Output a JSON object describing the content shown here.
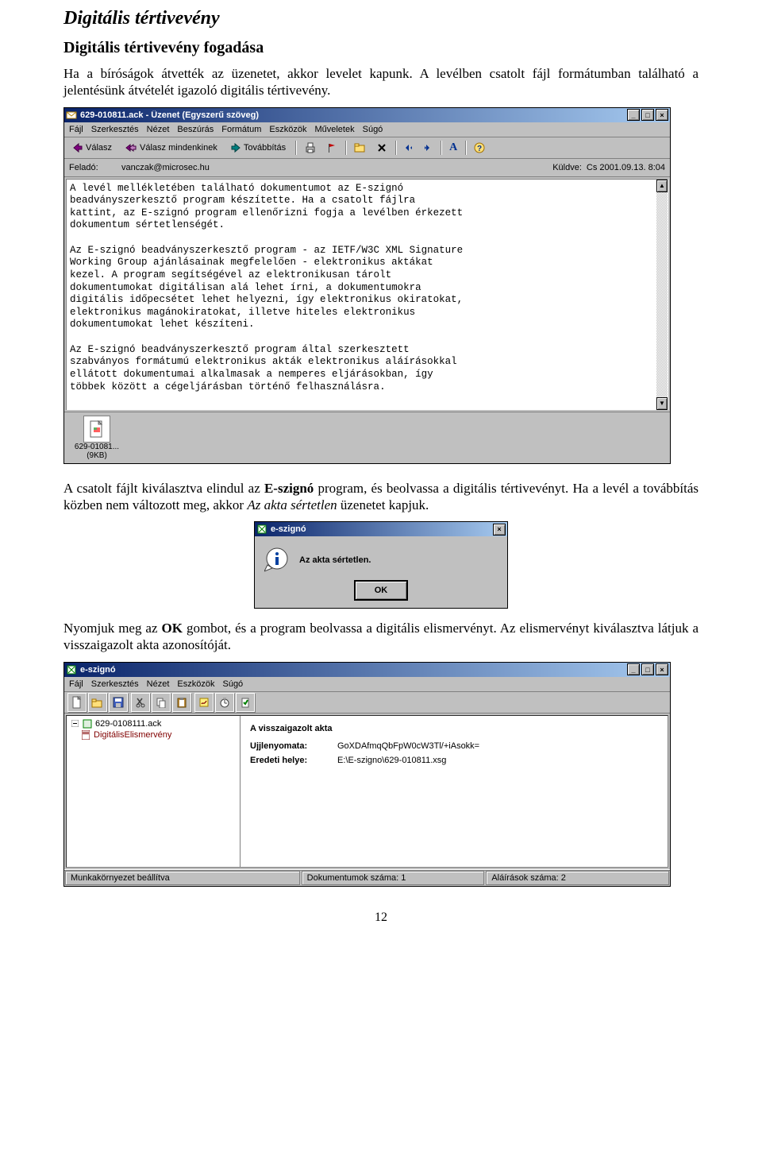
{
  "doc": {
    "h1": "Digitális tértivevény",
    "h2": "Digitális tértivevény fogadása",
    "p1": "Ha a bíróságok átvették az üzenetet, akkor levelet kapunk. A levélben csatolt fájl formátumban található a jelentésünk átvételét igazoló digitális tértivevény.",
    "p2_a": "A csatolt fájlt kiválasztva elindul az ",
    "p2_b": "E-szignó",
    "p2_c": " program, és beolvassa a digitális tértivevényt. Ha a levél a továbbítás közben nem változott meg, akkor ",
    "p2_d": "Az akta sértetlen",
    "p2_e": " üzenetet kapjuk.",
    "p3_a": "Nyomjuk meg az ",
    "p3_b": "OK",
    "p3_c": " gombot, és a program beolvassa a digitális elismervényt. Az elismervényt kiválasztva látjuk a visszaigazolt akta azonosítóját.",
    "page_number": "12"
  },
  "outlook": {
    "title": "629-010811.ack - Üzenet (Egyszerű szöveg)",
    "menu": [
      "Fájl",
      "Szerkesztés",
      "Nézet",
      "Beszúrás",
      "Formátum",
      "Eszközök",
      "Műveletek",
      "Súgó"
    ],
    "tb": {
      "reply": "Válasz",
      "reply_all": "Válasz mindenkinek",
      "forward": "Továbbítás"
    },
    "from_label": "Feladó:",
    "from_value": "vanczak@microsec.hu",
    "sent_label": "Küldve:",
    "sent_value": "Cs 2001.09.13. 8:04",
    "body": "A levél mellékletében található dokumentumot az E-szignó\nbeadványszerkesztő program készítette. Ha a csatolt fájlra\nkattint, az E-szignó program ellenőrizni fogja a levélben érkezett\ndokumentum sértetlenségét.\n\nAz E-szignó beadványszerkesztő program - az IETF/W3C XML Signature\nWorking Group ajánlásainak megfelelően - elektronikus aktákat\nkezel. A program segítségével az elektronikusan tárolt\ndokumentumokat digitálisan alá lehet írni, a dokumentumokra\ndigitális időpecsétet lehet helyezni, így elektronikus okiratokat,\nelektronikus magánokiratokat, illetve hiteles elektronikus\ndokumentumokat lehet készíteni.\n\nAz E-szignó beadványszerkesztő program által szerkesztett\nszabványos formátumú elektronikus akták elektronikus aláírásokkal\nellátott dokumentumai alkalmasak a nemperes eljárásokban, így\ntöbbek között a cégeljárásban történő felhasználásra.",
    "attachment_name": "629-01081...",
    "attachment_size": "(9KB)"
  },
  "msgbox": {
    "title": "e-szignó",
    "text": "Az akta sértetlen.",
    "ok": "OK"
  },
  "eszigno": {
    "title": "e-szignó",
    "menu": [
      "Fájl",
      "Szerkesztés",
      "Nézet",
      "Eszközök",
      "Súgó"
    ],
    "tree_root": "629-0108111.ack",
    "tree_child": "DigitálisElismervény",
    "detail_title": "A visszaigazolt akta",
    "k1": "Ujjlenyomata:",
    "v1": "GoXDAfmqQbFpW0cW3Tl/+iAsokk=",
    "k2": "Eredeti helye:",
    "v2": "E:\\E-szigno\\629-010811.xsg",
    "status1": "Munkakörnyezet beállítva",
    "status2": "Dokumentumok száma: 1",
    "status3": "Aláírások száma: 2"
  }
}
